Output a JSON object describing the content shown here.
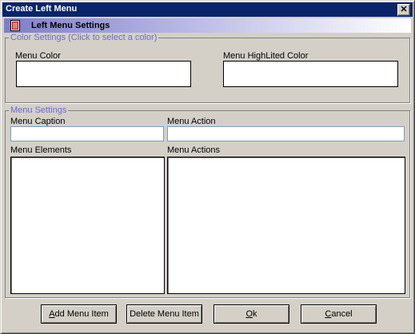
{
  "window": {
    "title": "Create Left Menu",
    "close_glyph": "✕"
  },
  "header": {
    "title": "Left Menu Settings",
    "icon": "document-icon"
  },
  "color_settings": {
    "legend": "Color Settings (Click to select a color)",
    "menu_color_label": "Menu Color",
    "menu_highlited_color_label": "Menu HighLited Color"
  },
  "menu_settings": {
    "legend": "Menu Settings",
    "caption_label": "Menu Caption",
    "caption_value": "",
    "action_label": "Menu Action",
    "action_value": "",
    "elements_label": "Menu Elements",
    "elements_items": [],
    "actions_label": "Menu Actions",
    "actions_items": []
  },
  "buttons": {
    "add": {
      "mnemonic": "A",
      "rest": "dd Menu Item"
    },
    "delete": {
      "label": "Delete Menu Item"
    },
    "ok": {
      "mnemonic": "O",
      "rest": "k"
    },
    "cancel": {
      "mnemonic": "C",
      "rest": "ancel"
    }
  },
  "colors": {
    "titlebar": "#0a246a",
    "legend_text": "#6b6bd0",
    "dialog_bg": "#d4d0c8"
  }
}
